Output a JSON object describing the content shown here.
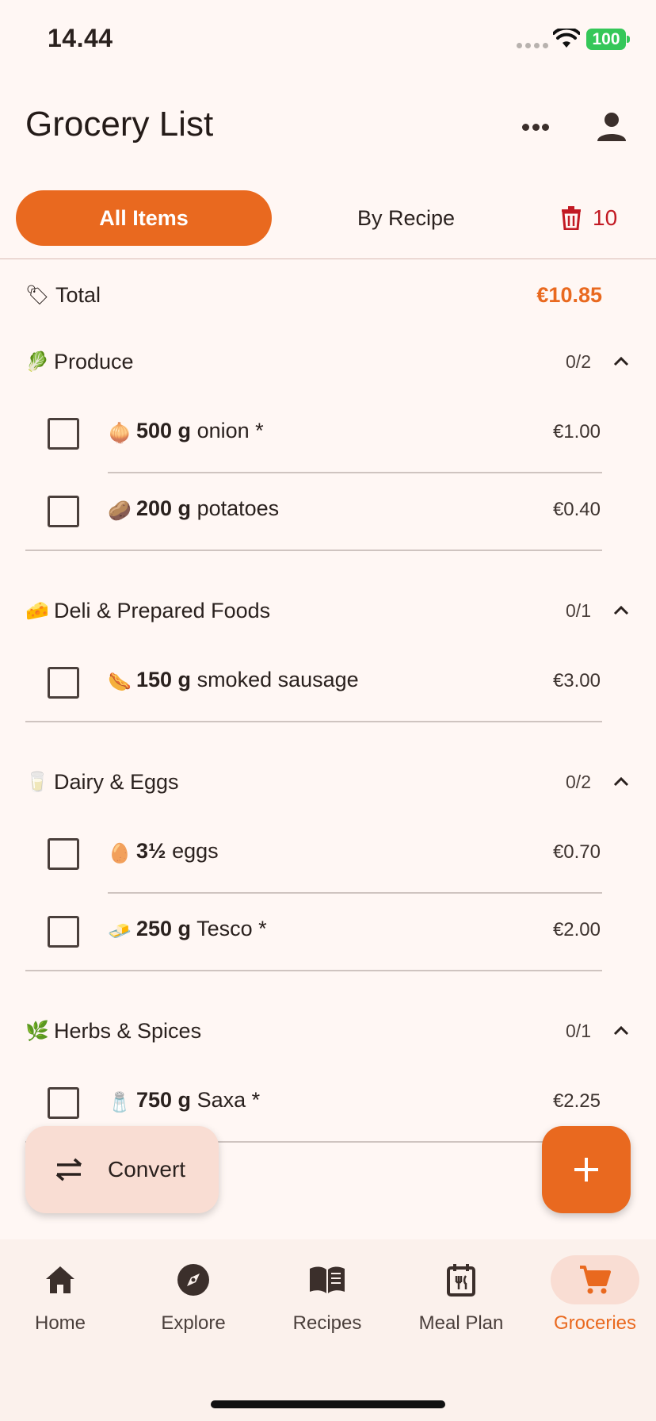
{
  "status_bar": {
    "time": "14.44",
    "battery": "100"
  },
  "header": {
    "title": "Grocery List"
  },
  "tabs": {
    "all_items": "All Items",
    "by_recipe": "By Recipe"
  },
  "delete": {
    "count": "10"
  },
  "total": {
    "emoji": "🏷",
    "label": "Total",
    "value": "€10.85"
  },
  "categories": [
    {
      "emoji": "🥬",
      "name": "Produce",
      "count": "0/2",
      "items": [
        {
          "emoji": "🧅",
          "qty": "500 g",
          "name": "onion *",
          "price": "€1.00"
        },
        {
          "emoji": "🥔",
          "qty": "200 g",
          "name": "potatoes",
          "price": "€0.40"
        }
      ]
    },
    {
      "emoji": "🧀",
      "name": "Deli & Prepared Foods",
      "count": "0/1",
      "items": [
        {
          "emoji": "🌭",
          "qty": "150 g",
          "name": "smoked sausage",
          "price": "€3.00"
        }
      ]
    },
    {
      "emoji": "🥛",
      "name": "Dairy & Eggs",
      "count": "0/2",
      "items": [
        {
          "emoji": "🥚",
          "qty": "3½",
          "name": "eggs",
          "price": "€0.70"
        },
        {
          "emoji": "🧈",
          "qty": "250 g",
          "name": "Tesco *",
          "price": "€2.00"
        }
      ]
    },
    {
      "emoji": "🌿",
      "name": "Herbs & Spices",
      "count": "0/1",
      "items": [
        {
          "emoji": "🧂",
          "qty": "750 g",
          "name": "Saxa *",
          "price": "€2.25"
        }
      ]
    }
  ],
  "convert": {
    "label": "Convert"
  },
  "nav": [
    {
      "label": "Home",
      "icon": "home-icon"
    },
    {
      "label": "Explore",
      "icon": "compass-icon"
    },
    {
      "label": "Recipes",
      "icon": "book-icon"
    },
    {
      "label": "Meal Plan",
      "icon": "calendar-icon"
    },
    {
      "label": "Groceries",
      "icon": "cart-icon",
      "active": true
    }
  ],
  "colors": {
    "accent": "#e9691f",
    "background": "#fff7f4",
    "danger": "#c21a23",
    "accent_soft": "#f9ddd3"
  }
}
